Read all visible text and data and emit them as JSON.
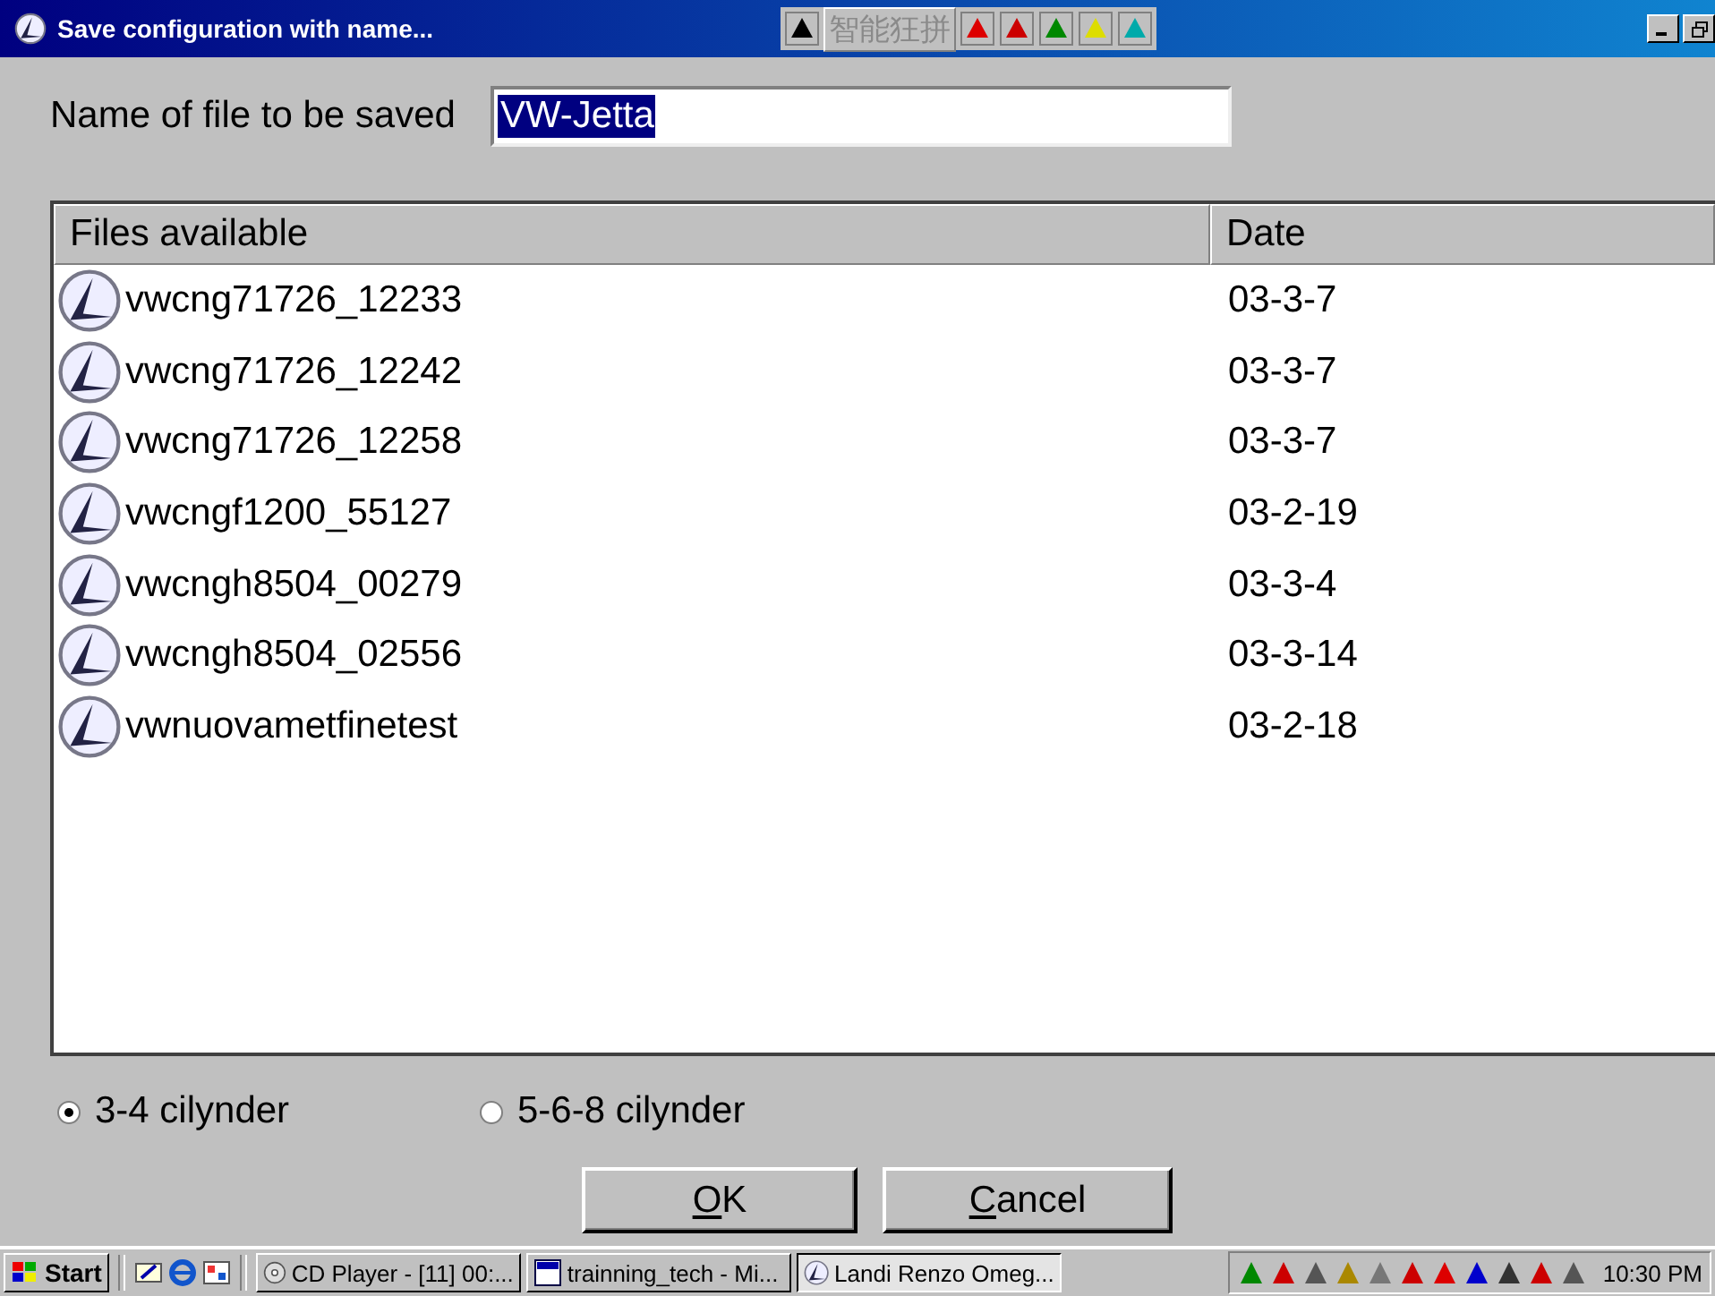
{
  "window": {
    "title": "Save configuration with name..."
  },
  "ime_toolbar": {
    "label": "智能狂拼"
  },
  "name_field": {
    "label": "Name of file to be saved",
    "value": "VW-Jetta"
  },
  "file_list": {
    "columns": [
      "Files available",
      "Date"
    ],
    "rows": [
      {
        "name": "vwcng71726_12233",
        "date": "03-3-7"
      },
      {
        "name": "vwcng71726_12242",
        "date": "03-3-7"
      },
      {
        "name": "vwcng71726_12258",
        "date": "03-3-7"
      },
      {
        "name": "vwcngf1200_55127",
        "date": "03-2-19"
      },
      {
        "name": "vwcngh8504_00279",
        "date": "03-3-4"
      },
      {
        "name": "vwcngh8504_02556",
        "date": "03-3-14"
      },
      {
        "name": "vwnuovametfinetest",
        "date": "03-2-18"
      }
    ]
  },
  "cylinder_options": [
    {
      "label": "3-4 cilynder",
      "selected": true
    },
    {
      "label": "5-6-8 cilynder",
      "selected": false
    }
  ],
  "buttons": [
    "OK",
    "Cancel"
  ],
  "taskbar": {
    "start": "Start",
    "tasks": [
      {
        "label": "CD Player - [11] 00:...",
        "kind": "cd",
        "selected": false
      },
      {
        "label": "trainning_tech - Mi...",
        "kind": "word",
        "selected": false
      },
      {
        "label": "Landi Renzo Omeg...",
        "kind": "app",
        "selected": true
      }
    ],
    "clock": "10:30 PM"
  }
}
